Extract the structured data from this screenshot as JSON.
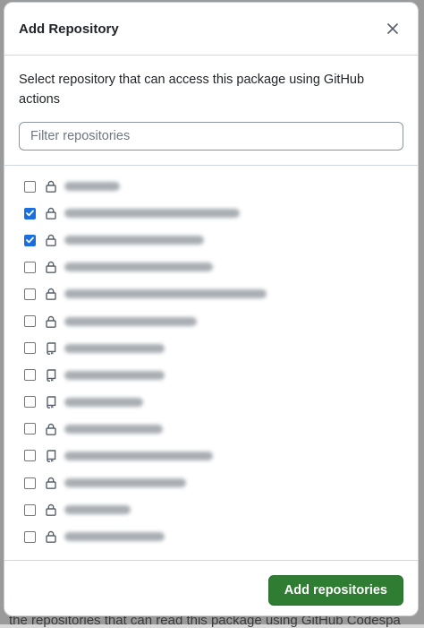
{
  "dialog": {
    "title": "Add Repository",
    "description": "Select repository that can access this package using GitHub actions",
    "filter_placeholder": "Filter repositories",
    "submit_label": "Add repositories"
  },
  "repositories": [
    {
      "checked": false,
      "icon": "lock-icon"
    },
    {
      "checked": true,
      "icon": "lock-icon"
    },
    {
      "checked": true,
      "icon": "lock-icon"
    },
    {
      "checked": false,
      "icon": "lock-icon"
    },
    {
      "checked": false,
      "icon": "lock-icon"
    },
    {
      "checked": false,
      "icon": "lock-icon"
    },
    {
      "checked": false,
      "icon": "repo-icon"
    },
    {
      "checked": false,
      "icon": "repo-icon"
    },
    {
      "checked": false,
      "icon": "repo-icon"
    },
    {
      "checked": false,
      "icon": "lock-icon"
    },
    {
      "checked": false,
      "icon": "repo-icon"
    },
    {
      "checked": false,
      "icon": "lock-icon"
    },
    {
      "checked": false,
      "icon": "lock-icon"
    },
    {
      "checked": false,
      "icon": "lock-icon"
    }
  ],
  "background": {
    "text": "the repositories that can read this package using GitHub Codespa"
  },
  "colors": {
    "primary_button": "#2f7d32",
    "checkbox_checked": "#1a6fe0"
  }
}
